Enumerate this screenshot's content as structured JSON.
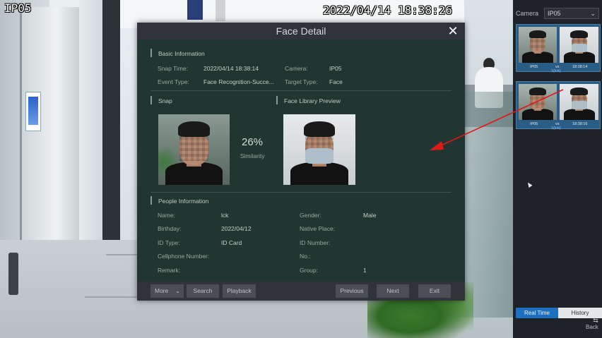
{
  "camera_overlay": {
    "label": "IP05",
    "timestamp": "2022/04/14 18:38:26"
  },
  "dialog": {
    "title": "Face Detail",
    "close_icon": "close-icon",
    "basic": {
      "heading": "Basic Information",
      "snap_time_label": "Snap Time:",
      "snap_time_value": "2022/04/14 18:38:14",
      "camera_label": "Camera:",
      "camera_value": "IP05",
      "event_type_label": "Event Type:",
      "event_type_value": "Face Recognition-Succe...",
      "target_type_label": "Target Type:",
      "target_type_value": "Face"
    },
    "snap": {
      "heading": "Snap",
      "similarity_value": "26%",
      "similarity_label": "Similarity"
    },
    "library": {
      "heading": "Face Library Preview"
    },
    "people": {
      "heading": "People Information",
      "name_label": "Name:",
      "name_value": "lck",
      "gender_label": "Gender:",
      "gender_value": "Male",
      "birthday_label": "Birthday:",
      "birthday_value": "2022/04/12",
      "native_place_label": "Native Place:",
      "native_place_value": "",
      "id_type_label": "ID Type:",
      "id_type_value": "ID Card",
      "id_number_label": "ID Number:",
      "id_number_value": "",
      "cellphone_label": "Cellphone Number:",
      "cellphone_value": "",
      "no_label": "No.:",
      "no_value": "",
      "remark_label": "Remark:",
      "remark_value": "",
      "group_label": "Group:",
      "group_value": "1"
    },
    "toolbar": {
      "more_label": "More",
      "search_label": "Search",
      "playback_label": "Playback",
      "previous_label": "Previous",
      "next_label": "Next",
      "exit_label": "Exit"
    }
  },
  "right_panel": {
    "camera_label": "Camera",
    "camera_select_value": "IP05",
    "matches": [
      {
        "camera": "IP05",
        "mark": "vs",
        "time": "18:38:14",
        "name": "1(lck)"
      },
      {
        "camera": "IP05",
        "mark": "vs",
        "time": "18:38:16",
        "name": "1(lck)"
      }
    ],
    "tabs": {
      "realtime": "Real Time",
      "history": "History"
    },
    "back_label": "Back",
    "back_icon": "back-arrow-icon"
  },
  "colors": {
    "dialog_bg": "#213630",
    "toolbar_bg": "#30333a",
    "active_tab": "#1d6fc0",
    "arrow": "#e01818"
  }
}
